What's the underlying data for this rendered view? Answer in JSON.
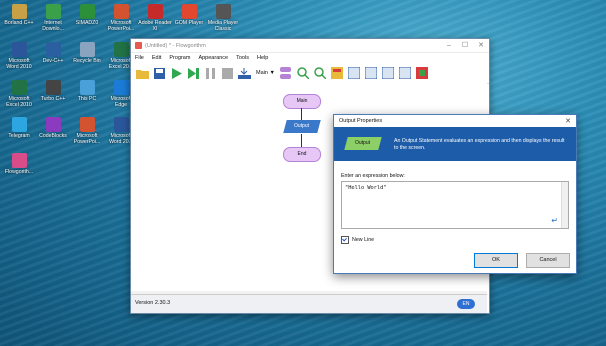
{
  "desktop_icons": [
    {
      "label": "Borland C++",
      "color": "#c8a045"
    },
    {
      "label": "Internet Downlo...",
      "color": "#3aa14a"
    },
    {
      "label": "SIMADZ0",
      "color": "#2c8f3a"
    },
    {
      "label": "Microsoft PowerPoi...",
      "color": "#d35230"
    },
    {
      "label": "Adobe Reader XI",
      "color": "#c62b2b"
    },
    {
      "label": "GOM Player",
      "color": "#e2482f"
    },
    {
      "label": "Media Player Classic",
      "color": "#555555"
    },
    {
      "label": "Microsoft Word 2010",
      "color": "#2b579a"
    },
    {
      "label": "Dev-C++",
      "color": "#2a5fa0"
    },
    {
      "label": "Recycle Bin",
      "color": "#8aa4c0"
    },
    {
      "label": "Microsoft Excel 20...",
      "color": "#217346"
    },
    {
      "label": "Microsoft Excel 2010",
      "color": "#217346"
    },
    {
      "label": "Turbo C++",
      "color": "#444444"
    },
    {
      "label": "This PC",
      "color": "#4aa0d8"
    },
    {
      "label": "Microsoft Edge",
      "color": "#1b7bd6"
    },
    {
      "label": "Telegram",
      "color": "#2ca5e0"
    },
    {
      "label": "CodeBlocks",
      "color": "#8a3bbf"
    },
    {
      "label": "Microsoft PowerPoi...",
      "color": "#d35230"
    },
    {
      "label": "Microsoft Word 20...",
      "color": "#2b579a"
    },
    {
      "label": "Flowgorith...",
      "color": "#d84c8a"
    }
  ],
  "app": {
    "title": "(Untitled) * - Flowgorithm",
    "menu": [
      "File",
      "Edit",
      "Program",
      "Appearance",
      "Tools",
      "Help"
    ],
    "toolbar_select": "Main",
    "version": "Version 2.30.3",
    "language_badge": "EN",
    "flowchart": {
      "start": "Main",
      "output": "Output",
      "end": "End"
    }
  },
  "dialog": {
    "title": "Output Properties",
    "shape_label": "Output",
    "description": "An Output Statement evaluates an expression and then displays the result to the screen.",
    "prompt": "Enter an expression below:",
    "expression": "\"Hello World\"",
    "newline_label": "New Line",
    "newline_checked": true,
    "ok_label": "OK",
    "cancel_label": "Cancel"
  }
}
